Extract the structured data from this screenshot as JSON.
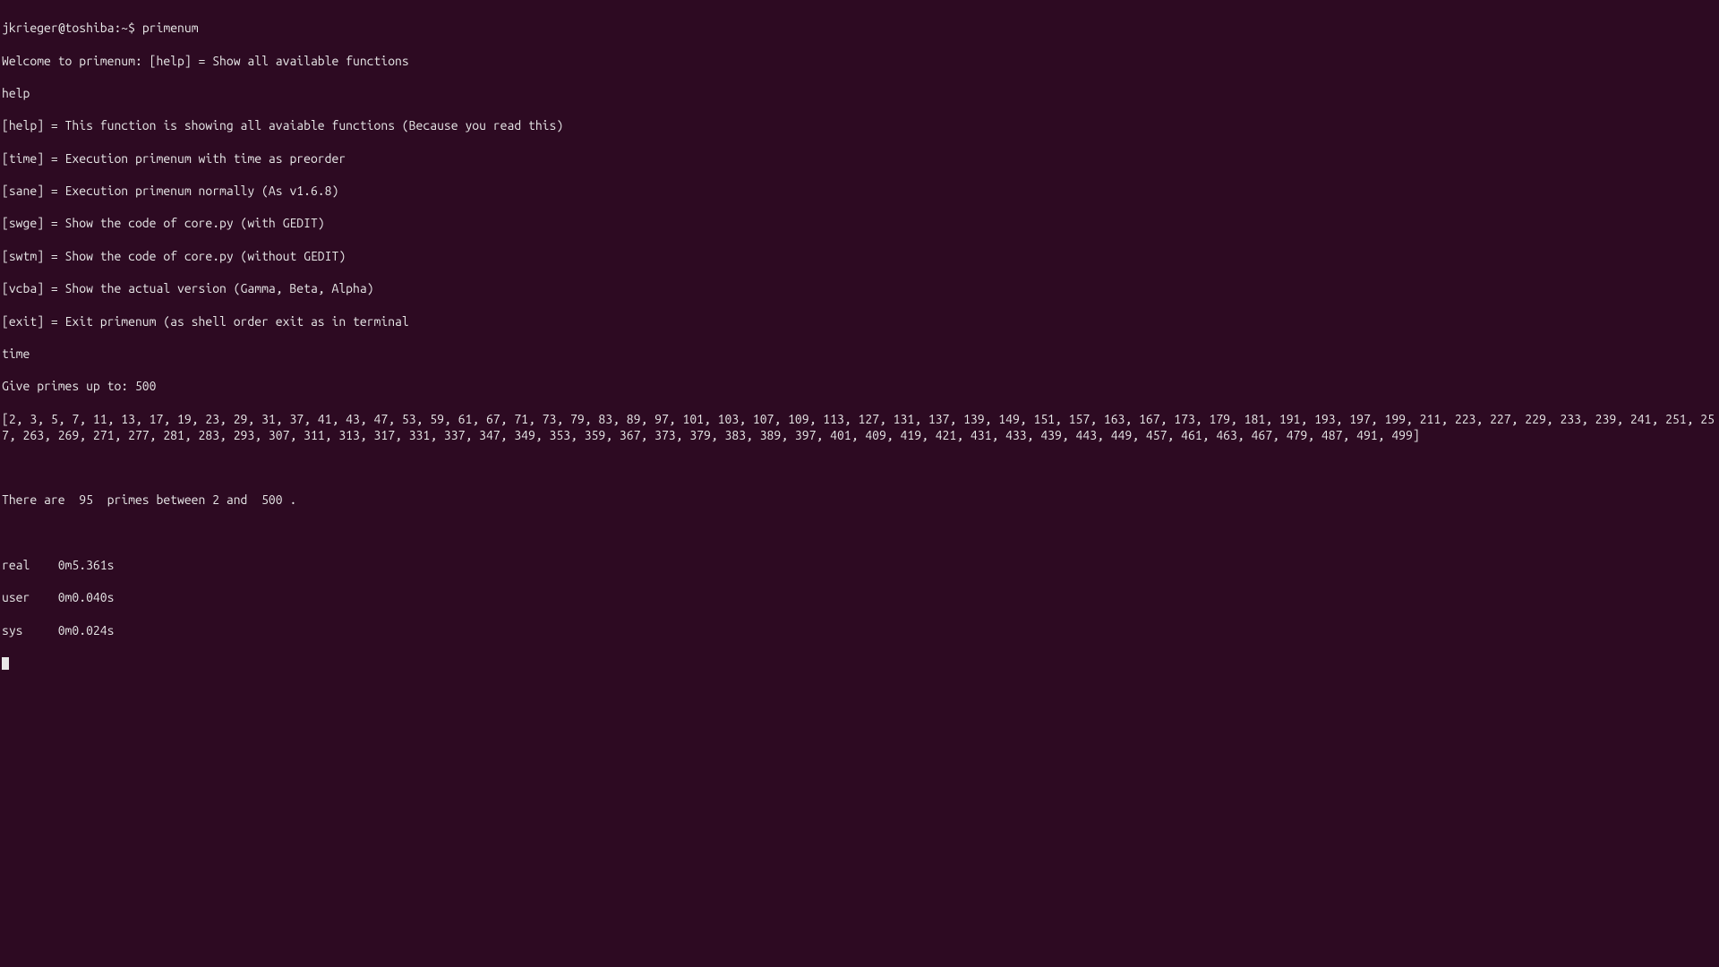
{
  "prompt": {
    "user_host": "jkrieger@toshiba",
    "path": ":~$ ",
    "command": "primenum"
  },
  "output": {
    "welcome": "Welcome to primenum: [help] = Show all available functions",
    "help_cmd": "help",
    "help_lines": [
      "[help] = This function is showing all avaiable functions (Because you read this)",
      "[time] = Execution primenum with time as preorder",
      "[sane] = Execution primenum normally (As v1.6.8)",
      "[swge] = Show the code of core.py (with GEDIT)",
      "[swtm] = Show the code of core.py (without GEDIT)",
      "[vcba] = Show the actual version (Gamma, Beta, Alpha)",
      "[exit] = Exit primenum (as shell order exit as in terminal"
    ],
    "time_cmd": "time",
    "give_primes": "Give primes up to: 500",
    "primes_list": "[2, 3, 5, 7, 11, 13, 17, 19, 23, 29, 31, 37, 41, 43, 47, 53, 59, 61, 67, 71, 73, 79, 83, 89, 97, 101, 103, 107, 109, 113, 127, 131, 137, 139, 149, 151, 157, 163, 167, 173, 179, 181, 191, 193, 197, 199, 211, 223, 227, 229, 233, 239, 241, 251, 257, 263, 269, 271, 277, 281, 283, 293, 307, 311, 313, 317, 331, 337, 347, 349, 353, 359, 367, 373, 379, 383, 389, 397, 401, 409, 419, 421, 431, 433, 439, 443, 449, 457, 461, 463, 467, 479, 487, 491, 499]",
    "count_line": "There are  95  primes between 2 and  500 .",
    "timing": {
      "real": "real    0m5.361s",
      "user": "user    0m0.040s",
      "sys": "sys     0m0.024s"
    }
  }
}
